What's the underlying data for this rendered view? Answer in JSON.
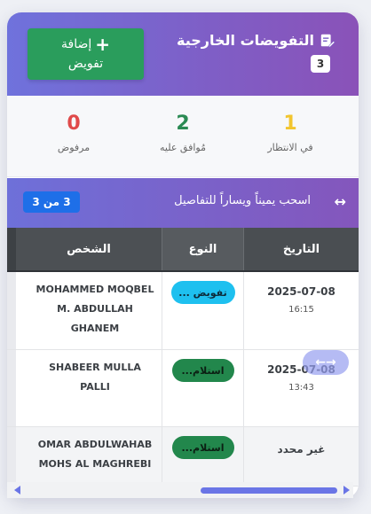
{
  "header": {
    "title": "التفويضات الخارجية",
    "count": "3",
    "add_button": {
      "line1": "إضافة",
      "line2": "تفويض",
      "icon": "plus-icon"
    },
    "title_icon": "document-edit-icon"
  },
  "stats": {
    "pending": {
      "value": "1",
      "label": "في الانتظار"
    },
    "approved": {
      "value": "2",
      "label": "مُوافق عليه"
    },
    "rejected": {
      "value": "0",
      "label": "مرفوض"
    }
  },
  "swipe_hint": {
    "text": "اسحب يميناً ويساراً للتفاصيل",
    "icon": "swipe-arrows-icon",
    "pagination": "3 من 3"
  },
  "table": {
    "columns": {
      "date": "التاريخ",
      "type": "النوع",
      "person": "الشخص"
    },
    "rows": [
      {
        "date": "2025-07-08",
        "time": "16:15",
        "type": "تفويض ...",
        "person": "MOHAMMED MOQBEL M. ABDULLAH GHANEM"
      },
      {
        "date": "2025-07-08",
        "time": "13:43",
        "type": "استلام...",
        "person": "SHABEER MULLA PALLI"
      },
      {
        "date": "غير محدد",
        "time": "",
        "type": "استلام...",
        "person": "OMAR ABDULWAHAB MOHS AL MAGHREBI"
      }
    ]
  },
  "float_hint_glyph": "→←",
  "colors": {
    "header_gradient_start": "#6f72dc",
    "header_gradient_end": "#8a52b8",
    "add_button": "#2a9d5c",
    "pending": "#f2c52e",
    "approved": "#2a8a53",
    "rejected": "#e04a4a",
    "pagination_pill": "#1e6fe8",
    "badge_tafweed": "#1ec0ef",
    "badge_istilam": "#22874c"
  }
}
